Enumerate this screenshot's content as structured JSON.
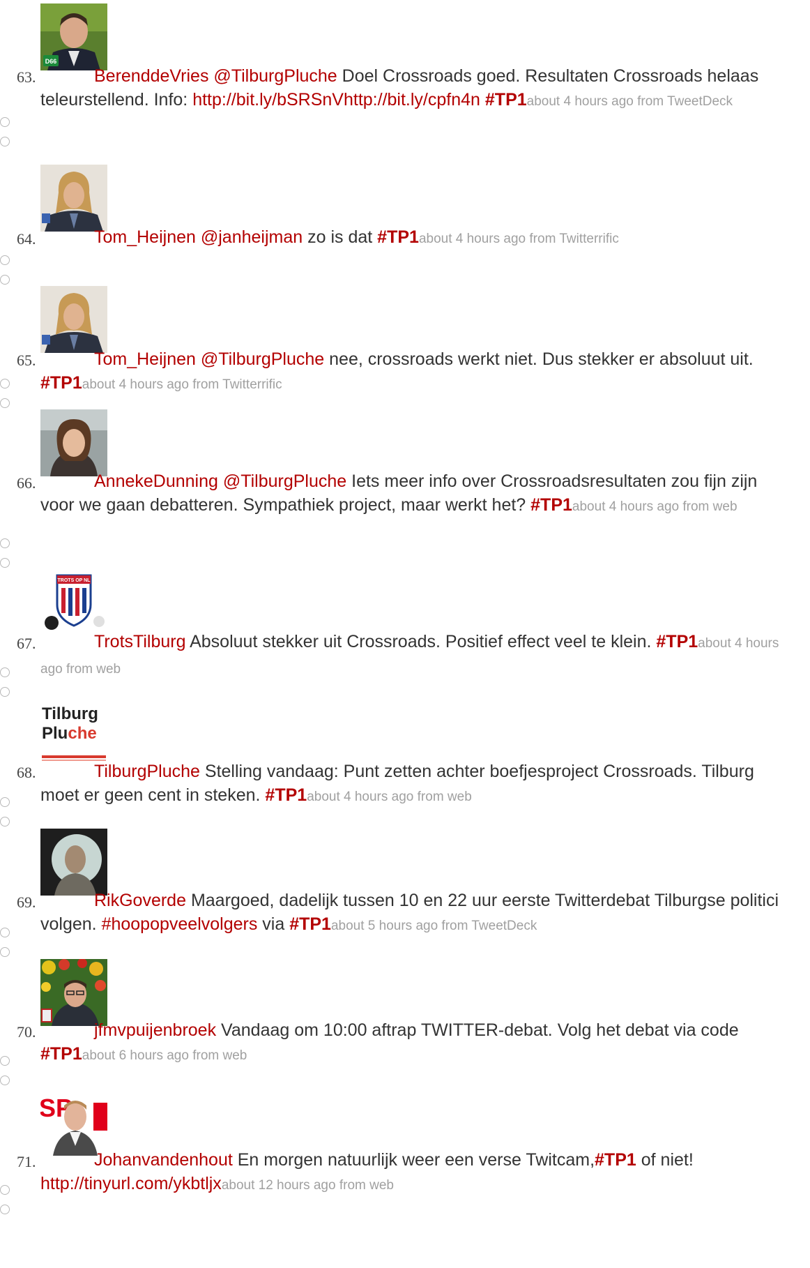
{
  "tweets": [
    {
      "number": "63.",
      "user": "BerenddeVries",
      "segments": [
        {
          "t": "mention",
          "v": "@TilburgPluche"
        },
        {
          "t": "text",
          "v": " Doel Crossroads goed. Resultaten Crossroads helaas teleurstellend. Info: "
        },
        {
          "t": "link",
          "v": "http://bit.ly/bSRSnVhttp://bit.ly/cpfn4n"
        },
        {
          "t": "text",
          "v": " "
        },
        {
          "t": "tag",
          "v": "#TP1"
        }
      ],
      "meta": "about 4 hours ago from TweetDeck",
      "avatar": "berend-photo-d66"
    },
    {
      "number": "64.",
      "user": "Tom_Heijnen",
      "segments": [
        {
          "t": "mention",
          "v": "@janheijman"
        },
        {
          "t": "text",
          "v": " zo is dat "
        },
        {
          "t": "tag",
          "v": "#TP1"
        }
      ],
      "meta": "about 4 hours ago from Twitterrific",
      "avatar": "tom-photo"
    },
    {
      "number": "65.",
      "user": "Tom_Heijnen",
      "segments": [
        {
          "t": "mention",
          "v": "@TilburgPluche"
        },
        {
          "t": "text",
          "v": " nee, crossroads werkt niet. Dus stekker er absoluut uit. "
        },
        {
          "t": "tag",
          "v": "#TP1"
        }
      ],
      "meta": "about 4 hours ago from Twitterrific",
      "avatar": "tom-photo"
    },
    {
      "number": "66.",
      "user": "AnnekeDunning",
      "segments": [
        {
          "t": "mention",
          "v": "@TilburgPluche"
        },
        {
          "t": "text",
          "v": " Iets meer info over Crossroadsresultaten zou fijn zijn voor we gaan debatteren. Sympathiek project, maar werkt het? "
        },
        {
          "t": "tag",
          "v": "#TP1"
        }
      ],
      "meta": "about 4 hours ago from web",
      "avatar": "anneke-photo"
    },
    {
      "number": "67.",
      "user": "TrotsTilburg",
      "segments": [
        {
          "t": "text",
          "v": " Absoluut stekker uit Crossroads. Positief effect veel te klein. "
        },
        {
          "t": "tag",
          "v": "#TP1"
        }
      ],
      "meta": "about 4 hours ago from web",
      "avatar": "trots-op-nl-logo",
      "avatar_text": "TROTS OP NL"
    },
    {
      "number": "68.",
      "user": "TilburgPluche",
      "segments": [
        {
          "t": "text",
          "v": " Stelling vandaag: Punt zetten achter boefjesproject Crossroads. Tilburg moet er geen cent in steken. "
        },
        {
          "t": "tag",
          "v": "#TP1"
        }
      ],
      "meta": "about 4 hours ago from web",
      "avatar": "tilburg-pluche-logo",
      "avatar_text_1": "Tilburg",
      "avatar_text_2a": "Plu",
      "avatar_text_2b": "che"
    },
    {
      "number": "69.",
      "user": "RikGoverde",
      "segments": [
        {
          "t": "text",
          "v": " Maargoed, dadelijk tussen 10 en 22 uur eerste Twitterdebat Tilburgse politici volgen. "
        },
        {
          "t": "link",
          "v": "#hoopopveelvolgers"
        },
        {
          "t": "text",
          "v": " via "
        },
        {
          "t": "tag",
          "v": "#TP1"
        }
      ],
      "meta": "about 5 hours ago from TweetDeck",
      "avatar": "rik-photo"
    },
    {
      "number": "70.",
      "user": "jfmvpuijenbroek",
      "segments": [
        {
          "t": "text",
          "v": " Vandaag om 10:00 aftrap TWITTER-debat. Volg het debat via code "
        },
        {
          "t": "tag",
          "v": "#TP1"
        }
      ],
      "meta": "about 6 hours ago from web",
      "avatar": "jfmv-photo"
    },
    {
      "number": "71.",
      "user": "Johanvandenhout",
      "segments": [
        {
          "t": "text",
          "v": " En morgen natuurlijk weer een verse Twitcam,"
        },
        {
          "t": "tag",
          "v": "#TP1"
        },
        {
          "t": "text",
          "v": " of niet! "
        },
        {
          "t": "link",
          "v": "http://tinyurl.com/ykbtljx"
        }
      ],
      "meta": "about 12 hours ago from web",
      "avatar": "johan-photo-sp",
      "avatar_text": "SP"
    }
  ],
  "colors": {
    "link": "#b30000",
    "text": "#333333",
    "meta": "#a0a0a0",
    "bullet": "#b8b8b8"
  }
}
